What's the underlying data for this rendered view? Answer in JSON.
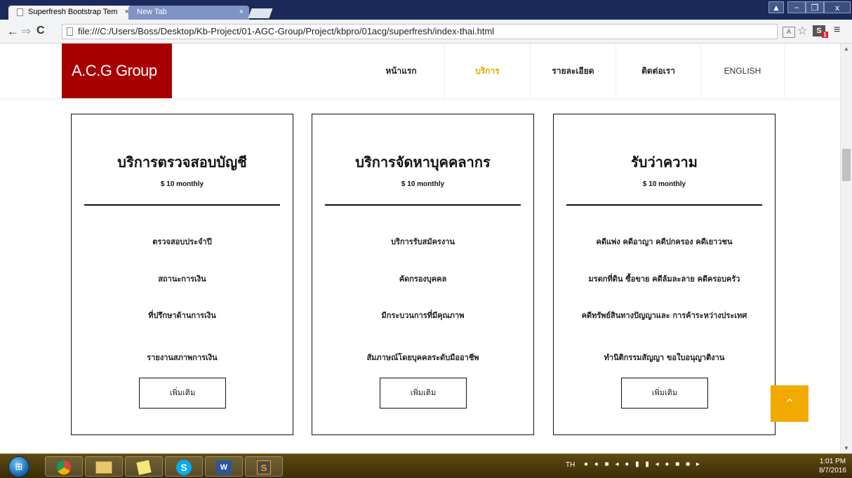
{
  "browser": {
    "tabs": [
      {
        "title": "Superfresh Bootstrap Tem",
        "close": "×"
      },
      {
        "title": "New Tab",
        "close": "×"
      }
    ],
    "url": "file:///C:/Users/Boss/Desktop/Kb-Project/01-AGC-Group/Project/kbpro/01acg/superfresh/index-thai.html",
    "window_controls": {
      "minimize": "−",
      "maximize": "❐",
      "close": "x"
    }
  },
  "site": {
    "brand": "A.C.G Group",
    "nav": [
      {
        "label": "หน้าแรก",
        "active": false
      },
      {
        "label": "บริการ",
        "active": true
      },
      {
        "label": "รายละเอียด",
        "active": false
      },
      {
        "label": "ติดต่อเรา",
        "active": false
      },
      {
        "label": "ENGLISH",
        "active": false
      }
    ],
    "active_color": "#e8a800",
    "brand_color": "#a80000"
  },
  "cards": [
    {
      "title": "บริการตรวจสอบบัญชี",
      "price": "$ 10 monthly",
      "features": [
        "ตรวจสอบประจำปี",
        "สถานะการเงิน",
        "ที่ปรึกษาด้านการเงิน",
        "รายงานสภาพการเงิน"
      ],
      "button": "เพิ่มเติม"
    },
    {
      "title": "บริการจัดหาบุคคลากร",
      "price": "$ 10 monthly",
      "features": [
        "บริการรับสมัครงาน",
        "คัดกรองบุคคล",
        "มีกระบวนการที่มีคุณภาพ",
        "สัมภาษณ์โดยบุคคลระดับมืออาชีพ"
      ],
      "button": "เพิ่มเติม"
    },
    {
      "title": "รับว่าความ",
      "price": "$ 10 monthly",
      "features": [
        "คดีแพ่ง คดีอาญา คดีปกครอง คดีเยาวชน",
        "มรดกที่ดิน ซื้อขาย คดีล้มละลาย คดีครอบครัว",
        "คดีทรัพย์สินทางปัญญาและ การค้าระหว่างประเทศ",
        "ทำนิติกรรมสัญญา ขอใบอนุญาติงาน"
      ],
      "button": "เพิ่มเติม"
    }
  ],
  "back_to_top": {
    "icon": "chevron-up-icon",
    "color": "#f2a900"
  },
  "taskbar": {
    "apps": [
      "chrome-icon",
      "file-explorer-icon",
      "sticky-notes-icon",
      "skype-icon",
      "word-icon",
      "sublime-text-icon"
    ],
    "language": "TH",
    "time": "1:01 PM",
    "date": "8/7/2016"
  }
}
